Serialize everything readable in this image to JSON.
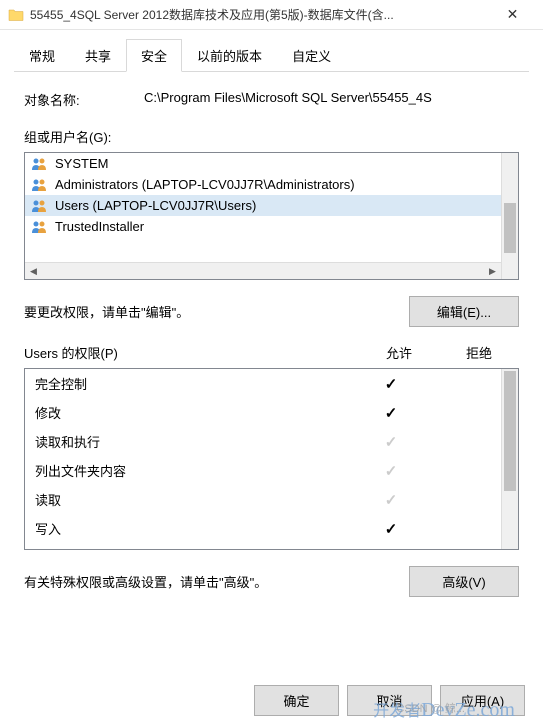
{
  "titlebar": {
    "text": "55455_4SQL Server 2012数据库技术及应用(第5版)-数据库文件(含..."
  },
  "tabs": {
    "items": [
      {
        "label": "常规"
      },
      {
        "label": "共享"
      },
      {
        "label": "安全"
      },
      {
        "label": "以前的版本"
      },
      {
        "label": "自定义"
      }
    ],
    "active": 2
  },
  "objectName": {
    "label": "对象名称:",
    "value": "C:\\Program Files\\Microsoft SQL Server\\55455_4S"
  },
  "groups": {
    "label": "组或用户名(G):",
    "items": [
      {
        "name": "SYSTEM"
      },
      {
        "name": "Administrators (LAPTOP-LCV0JJ7R\\Administrators)"
      },
      {
        "name": "Users (LAPTOP-LCV0JJ7R\\Users)"
      },
      {
        "name": "TrustedInstaller"
      }
    ],
    "selected": 2
  },
  "editRow": {
    "text": "要更改权限，请单击\"编辑\"。",
    "button": "编辑(E)..."
  },
  "permissions": {
    "header": "Users 的权限(P)",
    "allow": "允许",
    "deny": "拒绝",
    "items": [
      {
        "name": "完全控制",
        "allow": true,
        "deny": false
      },
      {
        "name": "修改",
        "allow": true,
        "deny": false
      },
      {
        "name": "读取和执行",
        "allow": "gray",
        "deny": false
      },
      {
        "name": "列出文件夹内容",
        "allow": "gray",
        "deny": false
      },
      {
        "name": "读取",
        "allow": "gray",
        "deny": false
      },
      {
        "name": "写入",
        "allow": true,
        "deny": false
      }
    ]
  },
  "advancedRow": {
    "text": "有关特殊权限或高级设置，请单击\"高级\"。",
    "button": "高级(V)"
  },
  "footer": {
    "ok": "确定",
    "cancel": "取消",
    "apply": "应用(A)"
  },
  "watermark": {
    "pre": "开发者",
    "main": "DevZe.com",
    "sub": "CSDN @ 鲸..."
  }
}
